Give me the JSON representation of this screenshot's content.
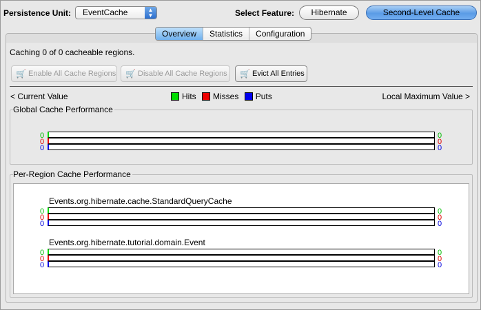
{
  "header": {
    "persistence_label": "Persistence Unit:",
    "persistence_value": "EventCache",
    "feature_label": "Select Feature:",
    "features": [
      "Hibernate",
      "Second-Level Cache"
    ],
    "selected_feature": "Second-Level Cache"
  },
  "tabs": [
    "Overview",
    "Statistics",
    "Configuration"
  ],
  "selected_tab": "Overview",
  "status": "Caching 0 of 0 cacheable regions.",
  "buttons": {
    "enable": "Enable All Cache Regions",
    "disable": "Disable All Cache Regions",
    "evict": "Evict All Entries"
  },
  "legend": {
    "left": "< Current Value",
    "right": "Local Maximum Value >",
    "hits": "Hits",
    "misses": "Misses",
    "puts": "Puts",
    "colors": {
      "hits": "#00dd00",
      "misses": "#ee0000",
      "puts": "#0000ee"
    }
  },
  "global": {
    "title": "Global Cache Performance",
    "hits": "0",
    "misses": "0",
    "puts": "0",
    "max_hits": "0",
    "max_misses": "0",
    "max_puts": "0"
  },
  "regions_title": "Per-Region Cache Performance",
  "regions": [
    {
      "name": "Events.org.hibernate.cache.StandardQueryCache",
      "hits": "0",
      "misses": "0",
      "puts": "0",
      "max_hits": "0",
      "max_misses": "0",
      "max_puts": "0"
    },
    {
      "name": "Events.org.hibernate.tutorial.domain.Event",
      "hits": "0",
      "misses": "0",
      "puts": "0",
      "max_hits": "0",
      "max_misses": "0",
      "max_puts": "0"
    }
  ]
}
